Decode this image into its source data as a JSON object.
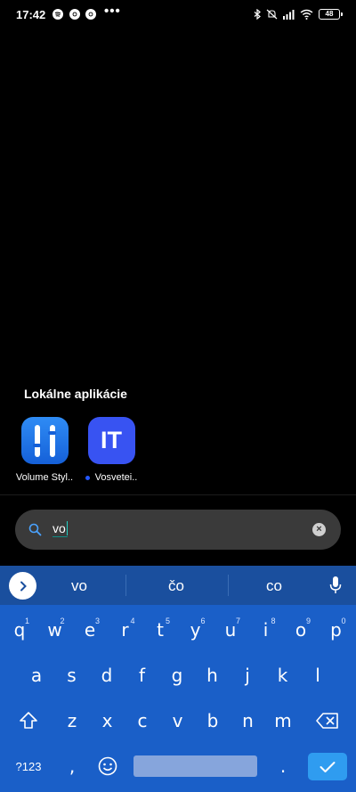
{
  "status_bar": {
    "time": "17:42",
    "more": "•••",
    "battery": "48",
    "notification_icons": [
      "spotify-icon",
      "chrome-icon",
      "chrome-icon"
    ],
    "system_icons": [
      "bluetooth-icon",
      "mute-icon",
      "signal-icon",
      "wifi-icon",
      "battery-icon"
    ]
  },
  "local_apps": {
    "title": "Lokálne aplikácie",
    "apps": [
      {
        "label": "Volume Styl..",
        "icon": "volume-styles-icon",
        "new": false
      },
      {
        "label": "Vosvetei..",
        "icon": "it-icon",
        "icon_text": "IT",
        "new": true
      }
    ]
  },
  "search": {
    "query": "vo",
    "clear_icon": "close-icon"
  },
  "keyboard": {
    "suggestions": [
      "vo",
      "čo",
      "co"
    ],
    "rows": [
      [
        {
          "k": "q",
          "n": "1"
        },
        {
          "k": "w",
          "n": "2"
        },
        {
          "k": "e",
          "n": "3"
        },
        {
          "k": "r",
          "n": "4"
        },
        {
          "k": "t",
          "n": "5"
        },
        {
          "k": "y",
          "n": "6"
        },
        {
          "k": "u",
          "n": "7"
        },
        {
          "k": "i",
          "n": "8"
        },
        {
          "k": "o",
          "n": "9"
        },
        {
          "k": "p",
          "n": "0"
        }
      ],
      [
        {
          "k": "a"
        },
        {
          "k": "s"
        },
        {
          "k": "d"
        },
        {
          "k": "f"
        },
        {
          "k": "g"
        },
        {
          "k": "h"
        },
        {
          "k": "j"
        },
        {
          "k": "k"
        },
        {
          "k": "l"
        }
      ],
      [
        {
          "k": "z"
        },
        {
          "k": "x"
        },
        {
          "k": "c"
        },
        {
          "k": "v"
        },
        {
          "k": "b"
        },
        {
          "k": "n"
        },
        {
          "k": "m"
        }
      ]
    ],
    "symbols_label": "?123",
    "comma": ",",
    "period": ".",
    "colors": {
      "background": "#1a5fc8",
      "suggestion_bar": "#1a4f9e",
      "enter": "#2f9cf0"
    }
  }
}
